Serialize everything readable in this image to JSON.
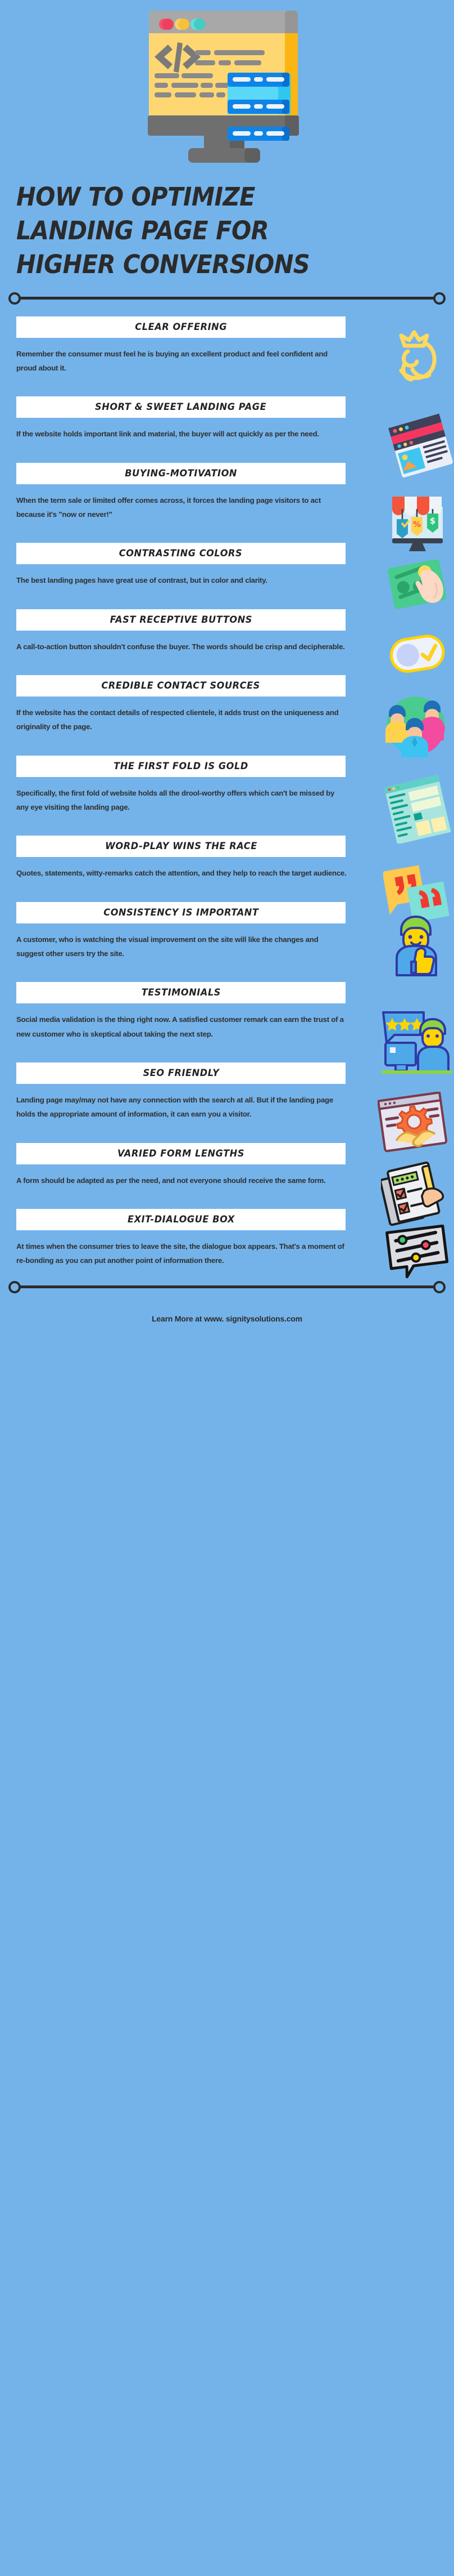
{
  "theme": {
    "background": "#74b3ea",
    "box_background": "#ffffff",
    "text_color": "#2f2f2f",
    "heading_color": "#232323",
    "divider_color": "#2b2b2b"
  },
  "header": {
    "illustration": "coding-monitor-icon",
    "title_lines": [
      "HOW TO OPTIMIZE",
      "LANDING PAGE FOR",
      "HIGHER CONVERSIONS"
    ]
  },
  "sections": [
    {
      "title": "CLEAR OFFERING",
      "body": "Remember the consumer must feel he is buying an excellent product and feel confident and proud about it.",
      "icon": "crown-badge-icon"
    },
    {
      "title": "SHORT & SWEET LANDING PAGE",
      "body": "If the website holds important link and material, the buyer will act quickly as per the need.",
      "icon": "webpage-tilted-icon"
    },
    {
      "title": "BUYING-MOTIVATION",
      "body": "When the term sale or limited offer comes across, it forces the landing page visitors to act because it's \"now or never!\"",
      "icon": "sale-shop-tags-icon"
    },
    {
      "title": "CONTRASTING COLORS",
      "body": "The best landing pages have great use of contrast, but in color and clarity.",
      "icon": "hand-tap-card-icon"
    },
    {
      "title": "FAST RECEPTIVE BUTTONS",
      "body": "A call-to-action button shouldn't confuse the buyer. The words should be crisp and decipherable.",
      "icon": "toggle-check-icon"
    },
    {
      "title": "CREDIBLE CONTACT SOURCES",
      "body": "If the website has the contact details of respected clientele, it adds trust on the uniqueness and originality of the page.",
      "icon": "people-group-icon"
    },
    {
      "title": "THE FIRST FOLD IS GOLD",
      "body": "Specifically, the first fold of website holds all the drool-worthy offers which can't be missed by any eye visiting the landing page.",
      "icon": "layout-wireframe-icon"
    },
    {
      "title": "WORD-PLAY WINS THE RACE",
      "body": "Quotes, statements, witty-remarks catch the attention, and they help to reach the target audience.",
      "icon": "quote-bubbles-icon"
    },
    {
      "title": "CONSISTENCY IS IMPORTANT",
      "body": "A customer, who is watching the visual improvement on the site will like the changes and suggest other users try the site.",
      "icon": "thumbs-up-person-icon"
    },
    {
      "title": "TESTIMONIALS",
      "body": "Social media validation is the thing right now. A satisfied customer remark can earn the trust of a new customer who is skeptical about taking the next step.",
      "icon": "star-review-person-icon"
    },
    {
      "title": "SEO FRIENDLY",
      "body": "Landing page may/may not have any connection with the search at all. But if the landing page holds the appropriate amount of information, it can earn you a visitor.",
      "icon": "handshake-gear-icon"
    },
    {
      "title": "VARIED FORM LENGTHS",
      "body": "A form should be adapted as per the need, and not everyone should receive the same form.",
      "icon": "checklist-pencil-icon"
    },
    {
      "title": "EXIT-DIALOGUE BOX",
      "body": "At times when the consumer tries to leave the site, the dialogue box appears. That's a moment of re-bonding as you can put another point of information there.",
      "icon": "settings-bubble-icon"
    }
  ],
  "footer": {
    "text": "Learn More at www. signitysolutions.com"
  }
}
